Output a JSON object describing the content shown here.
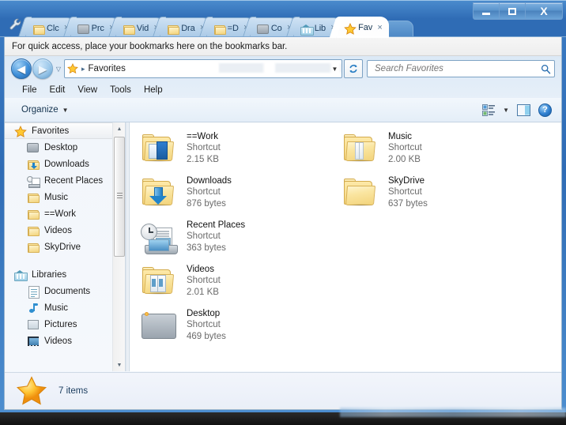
{
  "window": {
    "controls": [
      {
        "name": "minimize",
        "label": "–"
      },
      {
        "name": "maximize",
        "label": "□"
      },
      {
        "name": "close",
        "label": "X"
      }
    ]
  },
  "browser": {
    "wrench_icon": "wrench-icon",
    "tabs": [
      {
        "label": "Clc",
        "icon": "zip-folder-icon",
        "active": false,
        "close": "×"
      },
      {
        "label": "Prc",
        "icon": "app-window-icon",
        "active": false,
        "close": "×"
      },
      {
        "label": "Vid",
        "icon": "folder-icon",
        "active": false,
        "close": "×"
      },
      {
        "label": "Dra",
        "icon": "folder-icon",
        "active": false,
        "close": "×"
      },
      {
        "label": "=D",
        "icon": "folder-icon",
        "active": false,
        "close": "×"
      },
      {
        "label": "Co",
        "icon": "computer-icon",
        "active": false,
        "close": "×"
      },
      {
        "label": "Lib",
        "icon": "libraries-icon",
        "active": false,
        "close": "×"
      },
      {
        "label": "Fav",
        "icon": "star-icon",
        "active": true,
        "close": "×"
      }
    ],
    "new_tab_label": "",
    "bookmarks_bar_message": "For quick access, place your bookmarks here on the bookmarks bar."
  },
  "explorer": {
    "nav": {
      "back_label": "◀",
      "forward_label": "▶",
      "recent_label": "▽",
      "refresh_label": "↻"
    },
    "address": {
      "icon": "star-icon",
      "separator": "▸",
      "crumb": "Favorites",
      "dropdown_label": "▼"
    },
    "search": {
      "placeholder": "Search Favorites",
      "value": "",
      "icon": "search-icon"
    },
    "menubar": [
      "File",
      "Edit",
      "View",
      "Tools",
      "Help"
    ],
    "toolbar": {
      "organize_label": "Organize",
      "organize_caret": "▼",
      "view_caret": "▼",
      "help_label": "?"
    },
    "sidebar": [
      {
        "label": "Favorites",
        "icon": "star-icon",
        "level": "root",
        "selected": true
      },
      {
        "label": "Desktop",
        "icon": "desktop-icon",
        "level": "child",
        "selected": false
      },
      {
        "label": "Downloads",
        "icon": "downloads-folder-icon",
        "level": "child",
        "selected": false
      },
      {
        "label": "Recent Places",
        "icon": "recent-places-icon",
        "level": "child",
        "selected": false
      },
      {
        "label": "Music",
        "icon": "folder-icon",
        "level": "child",
        "selected": false
      },
      {
        "label": "==Work",
        "icon": "folder-icon",
        "level": "child",
        "selected": false
      },
      {
        "label": "Videos",
        "icon": "folder-icon",
        "level": "child",
        "selected": false
      },
      {
        "label": "SkyDrive",
        "icon": "folder-icon",
        "level": "child",
        "selected": false
      },
      {
        "label": "",
        "icon": "spacer",
        "level": "gap",
        "selected": false
      },
      {
        "label": "Libraries",
        "icon": "libraries-icon",
        "level": "root",
        "selected": false
      },
      {
        "label": "Documents",
        "icon": "documents-library-icon",
        "level": "child",
        "selected": false
      },
      {
        "label": "Music",
        "icon": "music-library-icon",
        "level": "child",
        "selected": false
      },
      {
        "label": "Pictures",
        "icon": "pictures-library-icon",
        "level": "child",
        "selected": false
      },
      {
        "label": "Videos",
        "icon": "videos-library-icon",
        "level": "child",
        "selected": false
      }
    ],
    "scrollbar": {
      "up": "▲",
      "down": "▼"
    },
    "files": [
      {
        "name": "==Work",
        "type": "Shortcut",
        "size": "2.15 KB",
        "icon": "work-folder-icon"
      },
      {
        "name": "Downloads",
        "type": "Shortcut",
        "size": "876 bytes",
        "icon": "downloads-folder-icon"
      },
      {
        "name": "Recent Places",
        "type": "Shortcut",
        "size": "363 bytes",
        "icon": "recent-places-icon"
      },
      {
        "name": "Videos",
        "type": "Shortcut",
        "size": "2.01 KB",
        "icon": "videos-folder-icon"
      },
      {
        "name": "Desktop",
        "type": "Shortcut",
        "size": "469 bytes",
        "icon": "desktop-icon"
      },
      {
        "name": "Music",
        "type": "Shortcut",
        "size": "2.00 KB",
        "icon": "music-folder-icon"
      },
      {
        "name": "SkyDrive",
        "type": "Shortcut",
        "size": "637 bytes",
        "icon": "skydrive-folder-icon"
      }
    ],
    "status": {
      "icon": "star-icon",
      "text": "7 items"
    }
  },
  "colors": {
    "titlebar_blue": "#2f6cb5",
    "accent_star": "#f5a623",
    "folder_yellow": "#f6d680",
    "link_text": "#14334f",
    "subtext_gray": "#6b6b6b"
  }
}
